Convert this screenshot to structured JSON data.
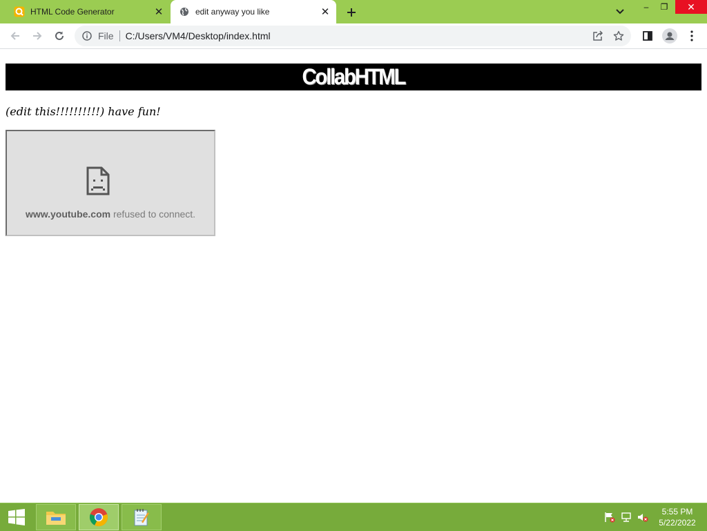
{
  "browser": {
    "tabs": [
      {
        "title": "HTML Code Generator",
        "active": false,
        "favicon": "code-generator-favicon"
      },
      {
        "title": "edit anyway you like",
        "active": true,
        "favicon": "globe-icon"
      }
    ],
    "address_bar": {
      "scheme_label": "File",
      "url": "C:/Users/VM4/Desktop/index.html"
    },
    "window_controls": {
      "minimize": "–",
      "restore": "❐",
      "close": "✕"
    }
  },
  "page": {
    "banner_title": "CollabHTML",
    "subtitle": "(edit this!!!!!!!!!!) have fun!",
    "embed": {
      "domain": "www.youtube.com",
      "message": " refused to connect."
    }
  },
  "taskbar": {
    "apps": [
      "file-explorer",
      "google-chrome",
      "notepad"
    ],
    "clock": {
      "time": "5:55 PM",
      "date": "5/22/2022"
    }
  },
  "colors": {
    "tabstrip": "#9bcc52",
    "taskbar": "#77ab3b",
    "banner_bg": "#000000",
    "close_button": "#e81123"
  }
}
